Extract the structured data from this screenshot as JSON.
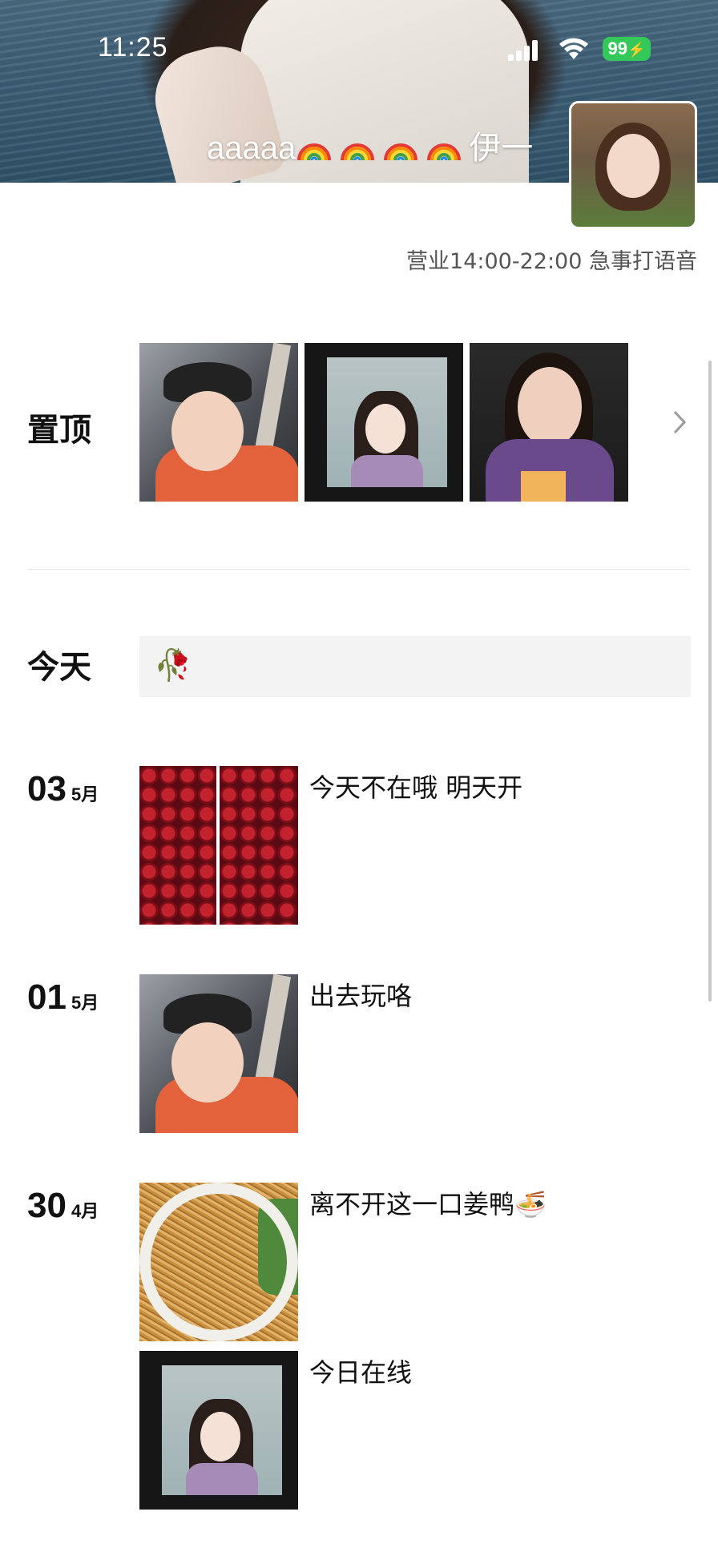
{
  "status_bar": {
    "time": "11:25",
    "battery": "99"
  },
  "profile": {
    "name_prefix": "aaaaa",
    "name_suffix": "伊一",
    "rainbow_icon": "rainbow-icon",
    "signature": "营业14:00-22:00 急事打语音"
  },
  "pinned": {
    "label": "置顶",
    "photos": [
      "selfie-in-car",
      "photo-on-phone-screen",
      "selfie-purple-top"
    ],
    "chevron_icon": "chevron-right-icon"
  },
  "today": {
    "label": "今天",
    "icon": "wilted-rose-icon",
    "icon_glyph": "🥀"
  },
  "posts": [
    {
      "day": "03",
      "month": "5月",
      "text": "今天不在哦 明天开",
      "photos": [
        "cherries-left",
        "cherries-right"
      ]
    },
    {
      "day": "01",
      "month": "5月",
      "text": "出去玩咯",
      "photos": [
        "selfie-in-car"
      ]
    },
    {
      "day": "30",
      "month": "4月",
      "text": "离不开这一口姜鸭",
      "emoji": "🍜",
      "photos": [
        "ginger-duck-noodles"
      ]
    },
    {
      "day": "",
      "month": "",
      "text": "今日在线",
      "photos": [
        "photo-on-phone-screen"
      ]
    }
  ],
  "colors": {
    "battery_green": "#34c759",
    "today_box": "#f3f3f3",
    "divider": "#e6e6e6"
  }
}
